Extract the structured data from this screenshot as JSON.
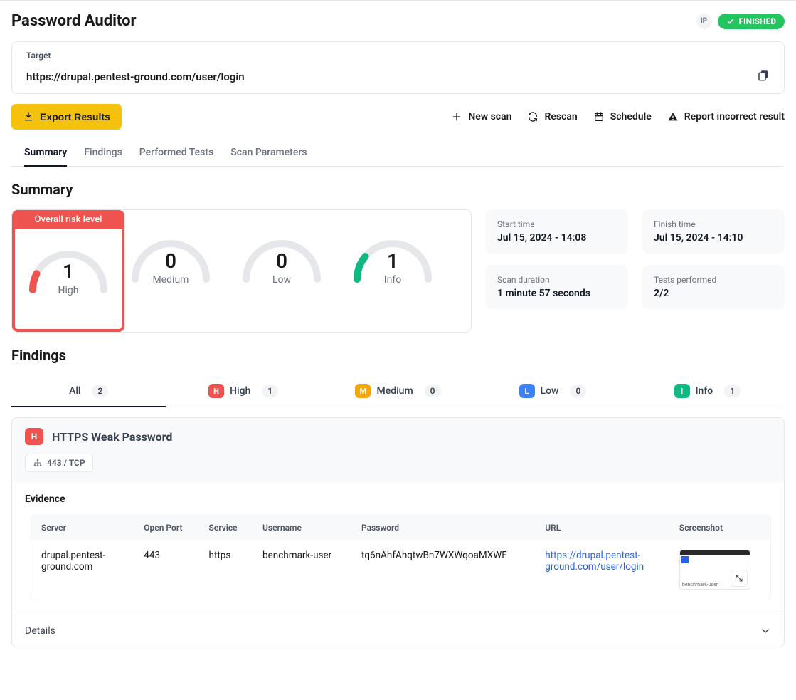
{
  "header": {
    "title": "Password Auditor",
    "ip_badge": "iP",
    "status": "FINISHED"
  },
  "target": {
    "label": "Target",
    "url": "https://drupal.pentest-ground.com/user/login"
  },
  "toolbar": {
    "export_label": "Export Results",
    "new_scan": "New scan",
    "rescan": "Rescan",
    "schedule": "Schedule",
    "report_incorrect": "Report incorrect result"
  },
  "tabs": {
    "summary": "Summary",
    "findings": "Findings",
    "performed_tests": "Performed Tests",
    "scan_parameters": "Scan Parameters"
  },
  "summary": {
    "section_title": "Summary",
    "overall_risk_label": "Overall risk level",
    "gauges": {
      "high": {
        "value": "1",
        "label": "High",
        "color": "#ef5350",
        "frac": 0.15
      },
      "medium": {
        "value": "0",
        "label": "Medium",
        "color": "#d1d5db",
        "frac": 0
      },
      "low": {
        "value": "0",
        "label": "Low",
        "color": "#d1d5db",
        "frac": 0
      },
      "info": {
        "value": "1",
        "label": "Info",
        "color": "#10b981",
        "frac": 0.22
      }
    },
    "stats": {
      "start_time_label": "Start time",
      "start_time": "Jul 15, 2024 - 14:08",
      "finish_time_label": "Finish time",
      "finish_time": "Jul 15, 2024 - 14:10",
      "duration_label": "Scan duration",
      "duration": "1 minute 57 seconds",
      "tests_label": "Tests performed",
      "tests": "2/2"
    }
  },
  "findings": {
    "section_title": "Findings",
    "tabs": {
      "all": {
        "label": "All",
        "count": "2"
      },
      "high": {
        "label": "High",
        "count": "1"
      },
      "medium": {
        "label": "Medium",
        "count": "0"
      },
      "low": {
        "label": "Low",
        "count": "0"
      },
      "info": {
        "label": "Info",
        "count": "1"
      }
    },
    "item": {
      "severity_letter": "H",
      "title": "HTTPS Weak Password",
      "port_chip": "443 / TCP",
      "evidence_label": "Evidence",
      "columns": {
        "server": "Server",
        "open_port": "Open Port",
        "service": "Service",
        "username": "Username",
        "password": "Password",
        "url": "URL",
        "screenshot": "Screenshot"
      },
      "row": {
        "server": "drupal.pentest-ground.com",
        "open_port": "443",
        "service": "https",
        "username": "benchmark-user",
        "password": "tq6nAhfAhqtwBn7WXWqoaMXWF",
        "url": "https://drupal.pentest-ground.com/user/login",
        "thumb_text": "benchmark-user"
      },
      "details_label": "Details"
    }
  }
}
